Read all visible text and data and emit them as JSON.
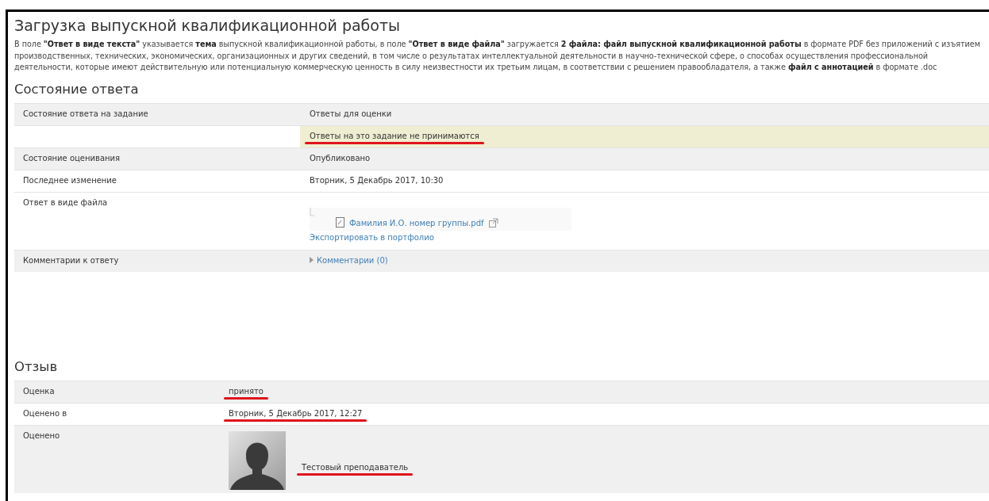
{
  "page": {
    "title": "Загрузка выпускной квалификационной работы",
    "description": "В поле **\"Ответ в виде текста\"** указывается **тема** выпускной квалификационной работы, в поле **\"Ответ в виде файла\"** загружается **2 файла: файл выпускной квалификационной работы** в формате PDF без приложений с изъятием производственных, технических, экономических, организационных и других сведений, в том числе о результатах интеллектуальной деятельности в научно-технической сфере, о способах осуществления профессиональной деятельности, которые имеют действительную или потенциальную коммерческую ценность в силу неизвестности их третьим лицам, в соответствии с решением правообладателя, а также **файл с аннотацией** в формате .doc",
    "sections": [
      {
        "heading": "Состояние ответа",
        "rows": [
          {
            "kind": "text",
            "label": "Состояние ответа на задание",
            "value": "Ответы для оценки",
            "shaded": true,
            "highlighted": false,
            "underlined": false
          },
          {
            "kind": "text",
            "value": "Ответы на это задание не принимаются",
            "shaded": false,
            "highlighted": true,
            "underlined": true
          },
          {
            "kind": "text",
            "label": "Состояние оценивания",
            "value": "Опубликовано",
            "shaded": true,
            "highlighted": false,
            "underlined": false
          },
          {
            "kind": "text",
            "label": "Последнее изменение",
            "value": "Вторник, 5 Декабрь 2017, 10:30",
            "shaded": false,
            "highlighted": false,
            "underlined": false
          },
          {
            "kind": "file",
            "label": "Ответ в виде файла",
            "file": "Фамилия И.О. номер группы.pdf",
            "export": "Экспортировать в портфолио",
            "shaded": false,
            "highlighted": false,
            "underlined": false
          },
          {
            "kind": "comments",
            "label": "Комментарии к ответу",
            "value": "Комментарии (0)",
            "shaded": true,
            "highlighted": false,
            "underlined": false
          }
        ]
      },
      {
        "heading": "Отзыв",
        "rows": [
          {
            "kind": "text",
            "label": "Оценка",
            "value": "принято",
            "shaded": true,
            "highlighted": false,
            "underlined": true
          },
          {
            "kind": "text",
            "label": "Оценено в",
            "value": "Вторник, 5 Декабрь 2017, 12:27",
            "shaded": false,
            "highlighted": false,
            "underlined": true
          },
          {
            "kind": "grader",
            "label": "Оценено",
            "value": "Тестовый преподаватель",
            "shaded": true,
            "highlighted": false,
            "underlined": true
          }
        ]
      }
    ]
  }
}
